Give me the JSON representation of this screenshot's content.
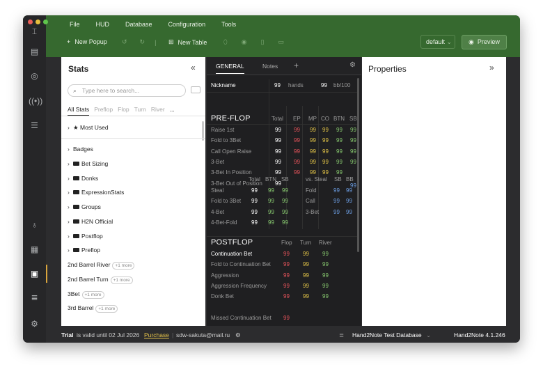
{
  "menu": [
    "File",
    "HUD",
    "Database",
    "Configuration",
    "Tools"
  ],
  "toolbar": {
    "new_popup": "New Popup",
    "new_table": "New Table",
    "profile": "default",
    "preview": "Preview"
  },
  "stats_panel": {
    "title": "Stats",
    "search_placeholder": "Type here to search...",
    "tabs": [
      "All Stats",
      "Preflop",
      "Flop",
      "Turn",
      "River",
      "..."
    ],
    "most_used": "Most Used",
    "items": [
      {
        "label": "Badges",
        "folder": false
      },
      {
        "label": "Bet Sizing",
        "folder": true
      },
      {
        "label": "Donks",
        "folder": true
      },
      {
        "label": "ExpressionStats",
        "folder": true
      },
      {
        "label": "Groups",
        "folder": true
      },
      {
        "label": "H2N Official",
        "folder": true
      },
      {
        "label": "Postflop",
        "folder": true
      },
      {
        "label": "Preflop",
        "folder": true
      }
    ],
    "stats": [
      {
        "label": "2nd Barrel River",
        "more": "+1 more"
      },
      {
        "label": "2nd Barrel Turn",
        "more": "+1 more"
      },
      {
        "label": "3Bet",
        "more": "+1 more"
      },
      {
        "label": "3rd Barrel",
        "more": "+1 more"
      }
    ]
  },
  "hud_panel": {
    "tabs": {
      "general": "GENERAL",
      "notes": "Notes",
      "add": "+"
    },
    "nickname": {
      "label": "Nickname",
      "hands_val": "99",
      "hands": "hands",
      "bb_val": "99",
      "bb": "bb/100"
    },
    "preflop": {
      "title": "PRE-FLOP",
      "headers": [
        "Total",
        "EP",
        "MP",
        "CO",
        "BTN",
        "SB"
      ],
      "rows": [
        {
          "label": "Raise 1st",
          "vals": [
            "99",
            "99",
            "99",
            "99",
            "99",
            "99"
          ]
        },
        {
          "label": "Fold to 3Bet",
          "vals": [
            "99",
            "99",
            "99",
            "99",
            "99",
            "99"
          ]
        },
        {
          "label": "Call Open Raise",
          "vals": [
            "99",
            "99",
            "99",
            "99",
            "99",
            "99"
          ]
        },
        {
          "label": "3-Bet",
          "vals": [
            "99",
            "99",
            "99",
            "99",
            "99",
            "99"
          ]
        },
        {
          "label": "3-Bet In Position",
          "vals": [
            "99",
            "99",
            "99",
            "99",
            "99"
          ]
        },
        {
          "label": "3-Bet Out of Position",
          "vals": [
            "99"
          ]
        }
      ]
    },
    "steal": {
      "headers": [
        "Total",
        "BTN",
        "SB"
      ],
      "rows": [
        {
          "label": "Steal",
          "vals": [
            "99",
            "99",
            "99"
          ]
        },
        {
          "label": "Fold to 3Bet",
          "vals": [
            "99",
            "99",
            "99"
          ]
        },
        {
          "label": "4-Bet",
          "vals": [
            "99",
            "99",
            "99"
          ]
        },
        {
          "label": "4-Bet-Fold",
          "vals": [
            "99",
            "99",
            "99"
          ]
        }
      ]
    },
    "vs_steal": {
      "headers": [
        "vs. Steal",
        "SB",
        "BB"
      ],
      "extra": "99",
      "rows": [
        {
          "label": "Fold",
          "vals": [
            "99",
            "99"
          ]
        },
        {
          "label": "Call",
          "vals": [
            "99",
            "99"
          ]
        },
        {
          "label": "3-Bet",
          "vals": [
            "99",
            "99"
          ]
        }
      ]
    },
    "postflop": {
      "title": "POSTFLOP",
      "headers": [
        "Flop",
        "Turn",
        "River"
      ],
      "rows": [
        {
          "label": "Continuation Bet",
          "vals": [
            "99",
            "99",
            "99"
          ]
        },
        {
          "label": "Fold to Continuation Bet",
          "vals": [
            "99",
            "99",
            "99"
          ]
        },
        {
          "label": "Aggression",
          "vals": [
            "99",
            "99",
            "99"
          ]
        },
        {
          "label": "Aggression Frequency",
          "vals": [
            "99",
            "99",
            "99"
          ]
        },
        {
          "label": "Donk Bet",
          "vals": [
            "99",
            "99",
            "99"
          ]
        }
      ],
      "missed_cb": {
        "label": "Missed Continuation Bet",
        "val": "99"
      }
    }
  },
  "properties_panel": {
    "title": "Properties"
  },
  "status": {
    "trial": "Trial",
    "valid": "is valid until 02 Jul 2026",
    "purchase": "Purchase",
    "email": "sdw-sakuta@mail.ru",
    "database": "Hand2Note Test Database",
    "version": "Hand2Note 4.1.246"
  }
}
